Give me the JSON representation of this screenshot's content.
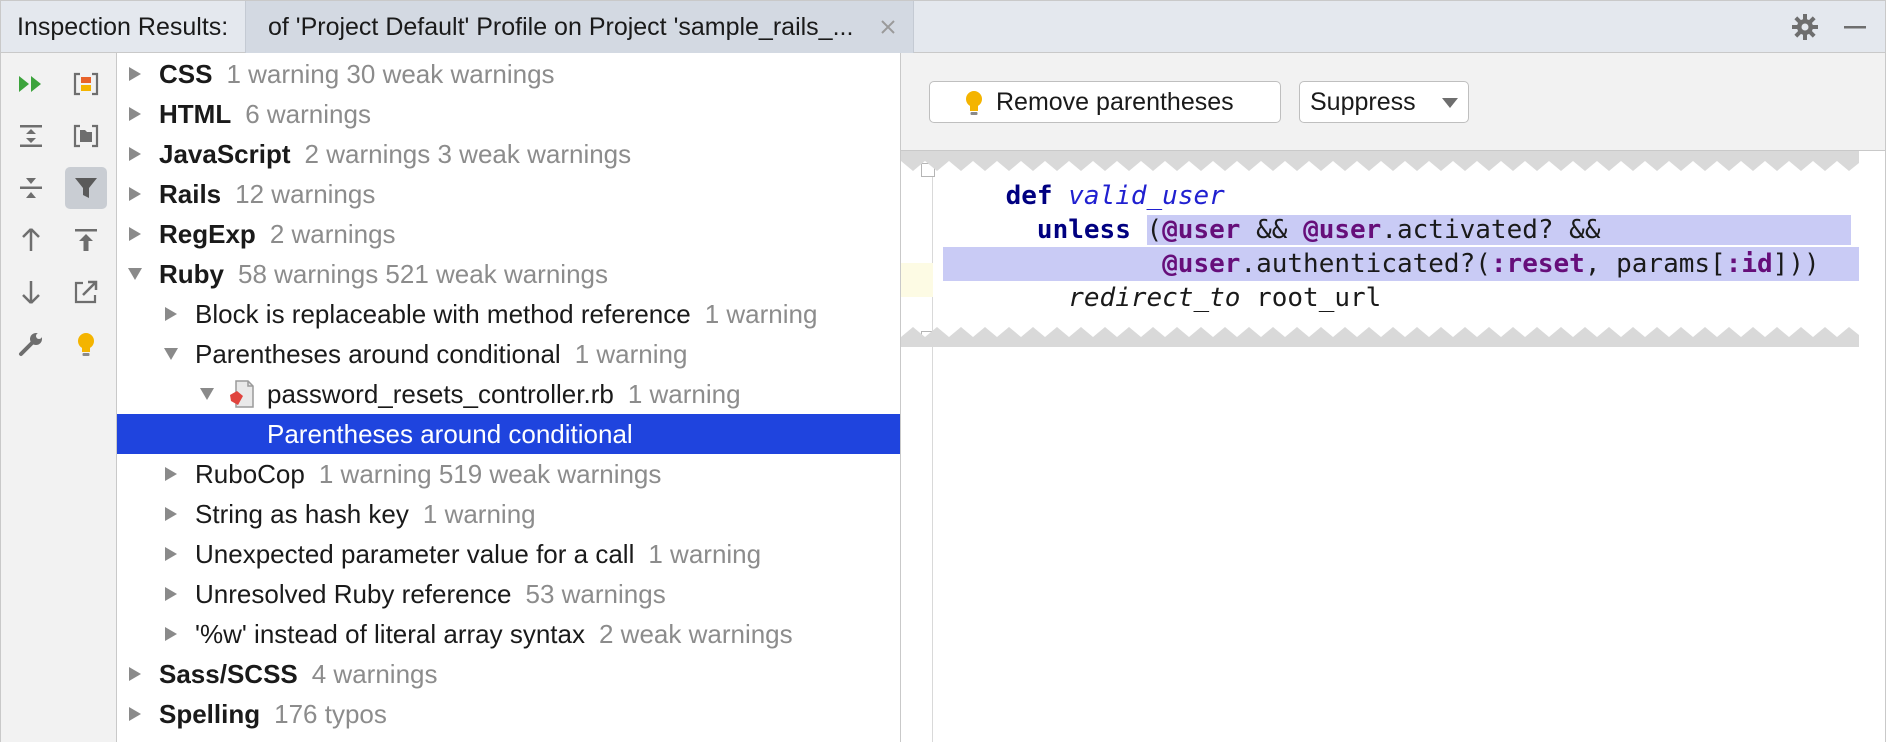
{
  "titlebar": {
    "title": "Inspection Results:",
    "tab_label": "of 'Project Default' Profile on Project 'sample_rails_...",
    "tab_close_icon": "close-icon",
    "settings_icon": "gear-icon",
    "minimize_icon": "minimize-icon"
  },
  "toolbar": {
    "buttons": [
      {
        "icon": "rerun-icon",
        "active": false
      },
      {
        "icon": "export-icon",
        "active": false
      },
      {
        "icon": "expand-all-icon",
        "active": false
      },
      {
        "icon": "group-by-directory-icon",
        "active": false
      },
      {
        "icon": "collapse-all-icon",
        "active": false
      },
      {
        "icon": "filter-icon",
        "active": true
      },
      {
        "icon": "previous-occurrence-icon",
        "active": false
      },
      {
        "icon": "autoscroll-from-source-icon",
        "active": false
      },
      {
        "icon": "next-occurrence-icon",
        "active": false
      },
      {
        "icon": "open-in-editor-icon",
        "active": false
      },
      {
        "icon": "edit-settings-icon",
        "active": false
      },
      {
        "icon": "quick-fix-bulb-icon",
        "active": false
      }
    ]
  },
  "tree": {
    "rows": [
      {
        "name": "CSS",
        "count": "1 warning 30 weak warnings",
        "bold": true,
        "expanded": false
      },
      {
        "name": "HTML",
        "count": "6 warnings",
        "bold": true,
        "expanded": false
      },
      {
        "name": "JavaScript",
        "count": "2 warnings 3 weak warnings",
        "bold": true,
        "expanded": false
      },
      {
        "name": "Rails",
        "count": "12 warnings",
        "bold": true,
        "expanded": false
      },
      {
        "name": "RegExp",
        "count": "2 warnings",
        "bold": true,
        "expanded": false
      },
      {
        "name": "Ruby",
        "count": "58 warnings 521 weak warnings",
        "bold": true,
        "expanded": true
      },
      {
        "name": "Block is replaceable with method reference",
        "count": "1 warning",
        "bold": false,
        "expanded": false
      },
      {
        "name": "Parentheses around conditional",
        "count": "1 warning",
        "bold": false,
        "expanded": true
      },
      {
        "name": "password_resets_controller.rb",
        "count": "1 warning",
        "bold": false,
        "expanded": true
      },
      {
        "name": "Parentheses around conditional",
        "count": "",
        "bold": false,
        "expanded": false
      },
      {
        "name": "RuboCop",
        "count": "1 warning 519 weak warnings",
        "bold": false,
        "expanded": false
      },
      {
        "name": "String as hash key",
        "count": "1 warning",
        "bold": false,
        "expanded": false
      },
      {
        "name": "Unexpected parameter value for a call",
        "count": "1 warning",
        "bold": false,
        "expanded": false
      },
      {
        "name": "Unresolved Ruby reference",
        "count": "53 warnings",
        "bold": false,
        "expanded": false
      },
      {
        "name": "'%w' instead of literal array syntax",
        "count": "2 weak warnings",
        "bold": false,
        "expanded": false
      },
      {
        "name": "Sass/SCSS",
        "count": "4 warnings",
        "bold": true,
        "expanded": false
      },
      {
        "name": "Spelling",
        "count": "176 typos",
        "bold": true,
        "expanded": false
      }
    ],
    "file_icon": "ruby-file-icon"
  },
  "detail": {
    "fix_button_label": "Remove parentheses",
    "fix_icon": "lightbulb-icon",
    "suppress_label": "Suppress",
    "code": {
      "line1": {
        "kw": "def",
        "fn": "valid_user"
      },
      "line2": {
        "kw": "unless",
        "p1": "(",
        "v1": "@user",
        "op1": " && ",
        "v2": "@user",
        "m1": ".activated? &&"
      },
      "line3": {
        "v3": "@user",
        "m2": ".authenticated?(",
        "s1": ":reset",
        "m3": ", params[",
        "s2": ":id",
        "m4": "]))"
      },
      "line4": {
        "call": "redirect_to",
        "arg": " root_url"
      }
    }
  },
  "colors": {
    "selection": "#1f44de",
    "highlight": "#c9cbf5",
    "keyword": "#000080",
    "instance_var": "#660e7a",
    "run_green": "#3ca33c",
    "bulb_yellow": "#f4b400"
  }
}
